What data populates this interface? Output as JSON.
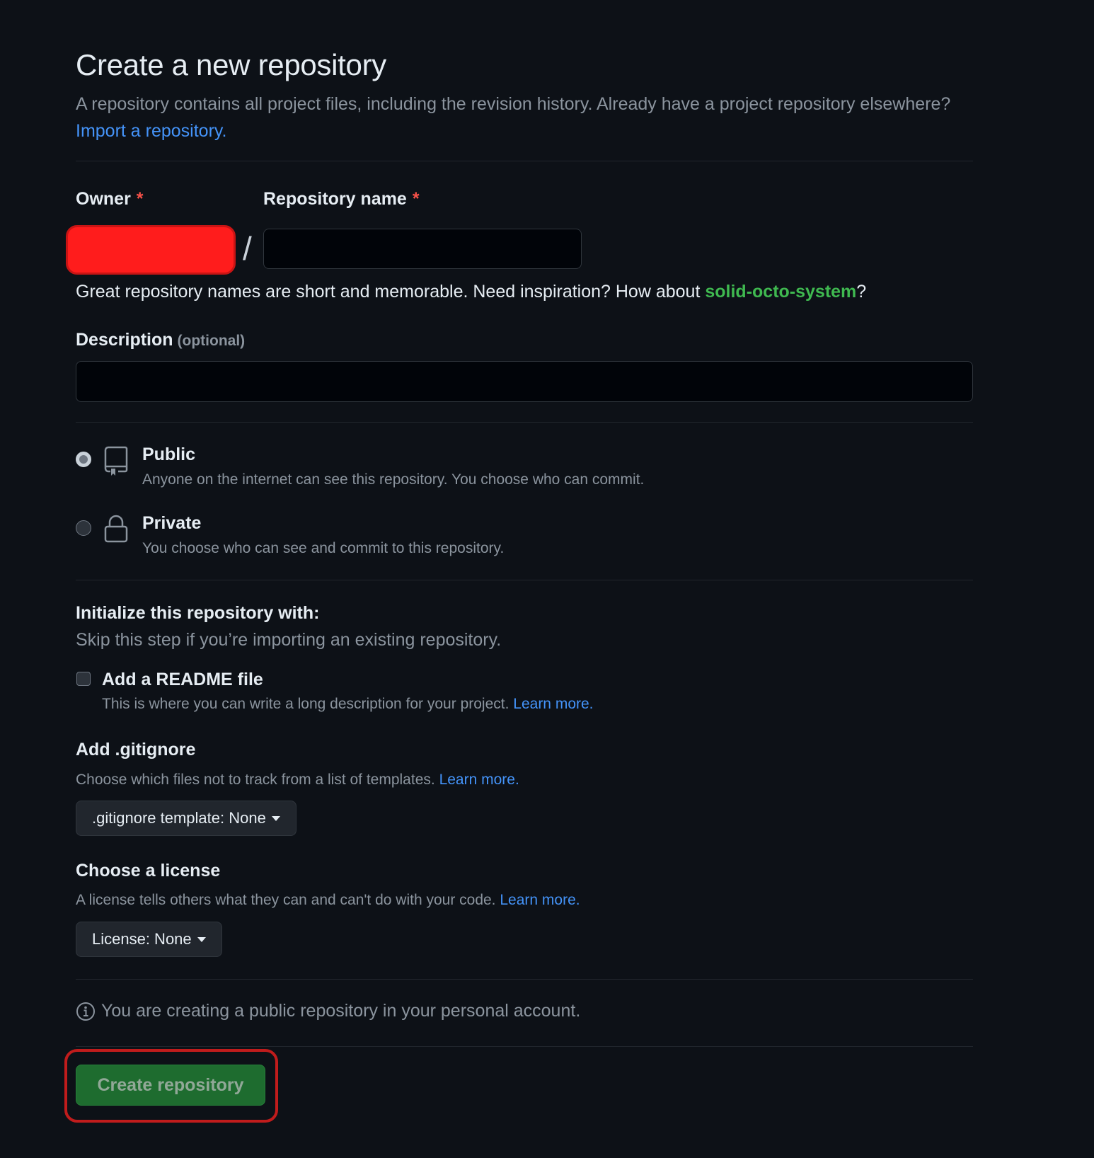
{
  "header": {
    "title": "Create a new repository",
    "intro_text": "A repository contains all project files, including the revision history. Already have a project repository elsewhere?",
    "import_link": "Import a repository."
  },
  "owner": {
    "label": "Owner",
    "required_mark": "*",
    "separator": "/"
  },
  "repo_name": {
    "label": "Repository name",
    "required_mark": "*",
    "value": "",
    "hint_prefix": "Great repository names are short and memorable. Need inspiration? How about",
    "suggestion": "solid-octo-system",
    "hint_suffix": "?"
  },
  "description": {
    "label": "Description",
    "optional": "(optional)",
    "value": ""
  },
  "visibility": {
    "public": {
      "title": "Public",
      "desc": "Anyone on the internet can see this repository. You choose who can commit.",
      "selected": true
    },
    "private": {
      "title": "Private",
      "desc": "You choose who can see and commit to this repository.",
      "selected": false
    }
  },
  "initialize": {
    "title": "Initialize this repository with:",
    "subtitle": "Skip this step if you’re importing an existing repository.",
    "readme": {
      "label": "Add a README file",
      "desc": "This is where you can write a long description for your project.",
      "link": "Learn more.",
      "checked": false
    }
  },
  "gitignore": {
    "title": "Add .gitignore",
    "desc": "Choose which files not to track from a list of templates.",
    "link": "Learn more.",
    "button": ".gitignore template: None"
  },
  "license": {
    "title": "Choose a license",
    "desc": "A license tells others what they can and can't do with your code.",
    "link": "Learn more.",
    "button": "License: None"
  },
  "info": {
    "text": "You are creating a public repository in your personal account."
  },
  "submit": {
    "label": "Create repository"
  },
  "colors": {
    "background": "#0d1117",
    "link": "#4493f8",
    "suggestion": "#3fb950",
    "primary_button": "#238636",
    "required": "#f85149",
    "redaction": "#ff1c1c",
    "highlight_ring": "#c01c1c"
  }
}
